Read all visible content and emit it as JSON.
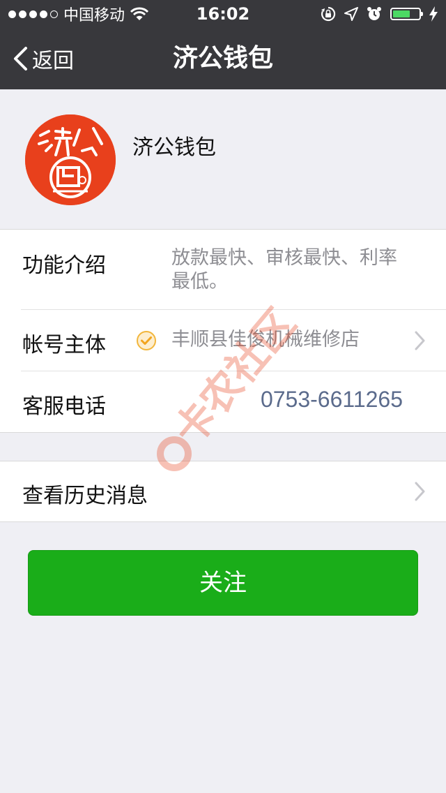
{
  "status_bar": {
    "carrier": "中国移动",
    "time": "16:02",
    "battery_color": "#4cd964"
  },
  "nav": {
    "back_label": "返回",
    "title": "济公钱包"
  },
  "profile": {
    "name": "济公钱包",
    "avatar_color": "#e8401c"
  },
  "info": {
    "intro": {
      "label": "功能介绍",
      "value": "放款最快、审核最快、利率最低。"
    },
    "account": {
      "label": "帐号主体",
      "value": "丰顺县佳俊机械维修店"
    },
    "phone": {
      "label": "客服电话",
      "value": "0753-6611265"
    }
  },
  "history": {
    "label": "查看历史消息"
  },
  "follow_button": {
    "label": "关注",
    "color": "#1aad19"
  },
  "watermark": {
    "text": "卡农社区"
  }
}
